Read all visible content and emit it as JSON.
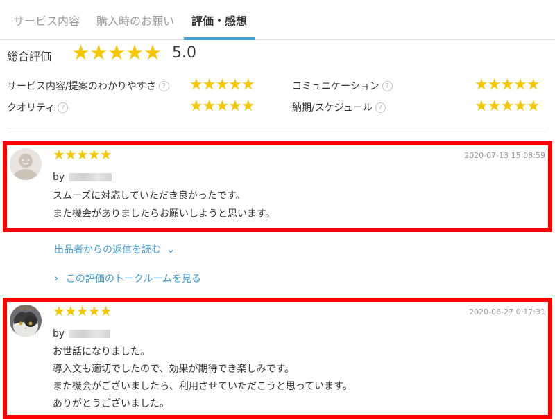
{
  "tabs": [
    {
      "label": "サービス内容"
    },
    {
      "label": "購入時のお願い"
    },
    {
      "label": "評価・感想"
    }
  ],
  "overall": {
    "label": "総合評価",
    "stars": "★★★★★",
    "score": "5.0"
  },
  "criteria": [
    {
      "label": "サービス内容/提案のわかりやすさ",
      "stars": "★★★★★"
    },
    {
      "label": "コミュニケーション",
      "stars": "★★★★★"
    },
    {
      "label": "クオリティ",
      "stars": "★★★★★"
    },
    {
      "label": "納期/スケジュール",
      "stars": "★★★★★"
    }
  ],
  "help_glyph": "?",
  "reviews": [
    {
      "stars": "★★★★★",
      "date": "2020-07-13 15:08:59",
      "by": "by",
      "lines": [
        "スムーズに対応していただき良かったです。",
        "また機会がありましたらお願いしようと思います。"
      ]
    },
    {
      "stars": "★★★★★",
      "date": "2020-06-27 0:17:31",
      "by": "by",
      "lines": [
        "お世話になりました。",
        "導入文も適切でしたので、効果が期待でき楽しみです。",
        "また機会がございましたら、利用させていただこうと思っています。",
        "ありがとうございました。"
      ]
    }
  ],
  "links": {
    "reply": "出品者からの返信を読む",
    "reply_icon": "⌄",
    "talkroom": "この評価のトークルームを見る",
    "talkroom_icon": "›"
  },
  "colors": {
    "accent": "#3ea0d6",
    "star": "#f6c700",
    "highlight": "#ff0000"
  }
}
